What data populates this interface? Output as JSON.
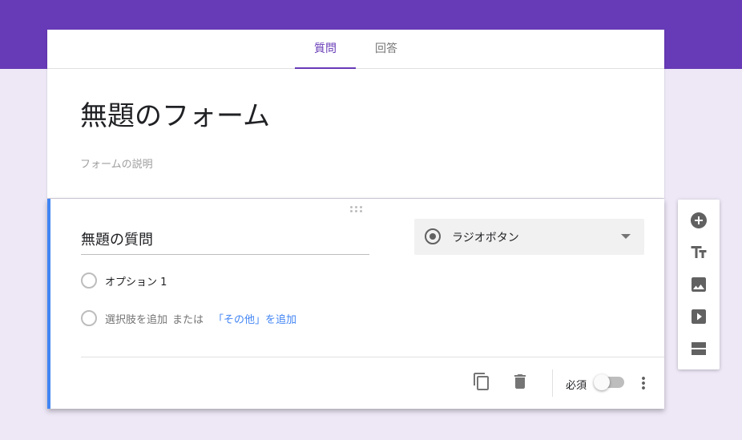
{
  "tabs": [
    {
      "label": "質問",
      "active": true
    },
    {
      "label": "回答",
      "active": false
    }
  ],
  "form": {
    "title": "無題のフォーム",
    "description_placeholder": "フォームの説明"
  },
  "question": {
    "title": "無題の質問",
    "type_label": "ラジオボタン",
    "options": [
      {
        "label": "オプション 1"
      }
    ],
    "add_option_label": "選択肢を追加",
    "or_label": "または",
    "add_other_label": "「その他」を追加",
    "required_label": "必須",
    "required": false
  },
  "colors": {
    "brand": "#673ab7",
    "background": "#ede7f6",
    "accent": "#4285f4"
  },
  "toolbar": {
    "icons": [
      "add-question-icon",
      "add-title-icon",
      "add-image-icon",
      "add-video-icon",
      "add-section-icon"
    ]
  }
}
